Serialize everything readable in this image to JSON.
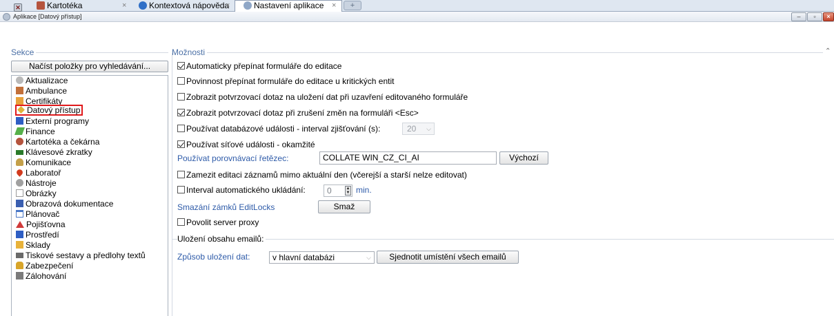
{
  "tabs": {
    "close_all_icon": "close-all-icon",
    "items": [
      {
        "label": "Kartotéka",
        "close": "×"
      },
      {
        "label_main": "Kontextová nápověda",
        "label_dim": "",
        "close": "×"
      },
      {
        "label": "Nastavení aplikace",
        "close": "×"
      }
    ],
    "new_tab": "+"
  },
  "window": {
    "title": "Aplikace [Datový přístup]",
    "min": "‒",
    "max": "▫",
    "close": "×"
  },
  "sections": {
    "left_title": "Sekce",
    "right_title": "Možnosti"
  },
  "sidebar": {
    "load_button": "Načíst položky pro vyhledávání...",
    "items": [
      {
        "label": "Aktualizace",
        "color": "#b9b9b9"
      },
      {
        "label": "Ambulance",
        "color": "#c2703a"
      },
      {
        "label": "Certifikáty",
        "color": "#e8a23c"
      },
      {
        "label": "Datový přístup",
        "color": "#e0b43a"
      },
      {
        "label": "Externí programy",
        "color": "#2e5ec4"
      },
      {
        "label": "Finance",
        "color": "#56b04a"
      },
      {
        "label": "Kartotéka a čekárna",
        "color": "#b5543e"
      },
      {
        "label": "Klávesové zkratky",
        "color": "#2a7a2a"
      },
      {
        "label": "Komunikace",
        "color": "#c4a04a"
      },
      {
        "label": "Laboratoř",
        "color": "#d23a1e"
      },
      {
        "label": "Nástroje",
        "color": "#a0a0a0"
      },
      {
        "label": "Obrázky",
        "color": "#d8d8d8"
      },
      {
        "label": "Obrazová dokumentace",
        "color": "#3a5fb0"
      },
      {
        "label": "Plánovač",
        "color": "#4a78c8"
      },
      {
        "label": "Pojišťovna",
        "color": "#d03a3a"
      },
      {
        "label": "Prostředí",
        "color": "#2e5ec4"
      },
      {
        "label": "Sklady",
        "color": "#e8b23a"
      },
      {
        "label": "Tiskové sestavy a předlohy textů",
        "color": "#6a6a6a"
      },
      {
        "label": "Zabezpečení",
        "color": "#d8a52a"
      },
      {
        "label": "Zálohování",
        "color": "#7a7a7a"
      }
    ],
    "selected_index": 3
  },
  "options": {
    "auto_edit": {
      "label": "Automaticky přepínat formuláře do editace",
      "checked": true
    },
    "critical_edit": {
      "label": "Povinnost přepínat formuláře do editace u kritických entit",
      "checked": false
    },
    "confirm_save": {
      "label": "Zobrazit potvrzovací dotaz na uložení dat při uzavření editovaného formuláře",
      "checked": false
    },
    "confirm_cancel": {
      "label": "Zobrazit potvrzovací dotaz při zrušení změn na formuláři <Esc>",
      "checked": true
    },
    "db_events": {
      "label": "Používat databázové události - interval zjišťování (s):",
      "checked": false,
      "interval": "20"
    },
    "net_events": {
      "label": "Používat síťové události - okamžité",
      "checked": true
    },
    "collate_label": "Používat porovnávací řetězec:",
    "collate_value": "COLLATE WIN_CZ_CI_AI",
    "collate_default_button": "Výchozí",
    "lock_edit": {
      "label": "Zamezit editaci záznamů mimo aktuální den (včerejší a starší nelze editovat)",
      "checked": false
    },
    "autosave": {
      "label": "Interval automatického ukládání:",
      "checked": false,
      "value": "0",
      "unit": "min."
    },
    "editlocks_label": "Smazání zámků EditLocks",
    "editlocks_button": "Smaž",
    "proxy": {
      "label": "Povolit server proxy",
      "checked": false
    }
  },
  "email": {
    "title": "Uložení obsahu emailů:",
    "method_label": "Způsob uložení dat:",
    "method_value": "v hlavní databázi",
    "unify_button": "Sjednotit umístění všech emailů"
  },
  "collapse_icon": "collapse-up-icon",
  "colors": {
    "accent_blue": "#2d5aa8",
    "section_blue": "#4a6fa5",
    "selection_red": "#e0191b"
  }
}
